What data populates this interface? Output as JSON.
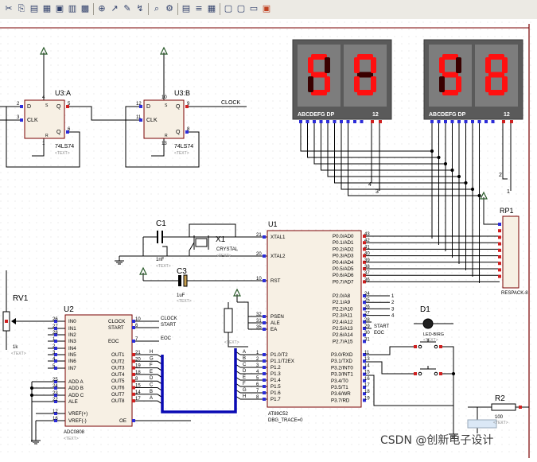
{
  "toolbar": {
    "icons": [
      "cut-icon",
      "copy-icon",
      "paste-icon",
      "block-copy-icon",
      "block-move-icon",
      "block-rotate-icon",
      "block-delete-icon",
      "zoom-in-icon",
      "pick-device-icon",
      "make-device-icon",
      "wire-autorouter-icon",
      "search-icon",
      "property-tool-icon",
      "netlist-icon",
      "bill-of-materials-icon",
      "design-explorer-icon",
      "new-sheet-icon",
      "remove-sheet-icon",
      "zoom-to-child-icon",
      "report-icon"
    ]
  },
  "display1": {
    "digits": [
      "5",
      "0"
    ],
    "pins": "ABCDEFG DP",
    "pin2": "12"
  },
  "display2": {
    "digits": [
      "5",
      "8"
    ],
    "pins": "ABCDEFG DP",
    "pin2": "12"
  },
  "flipflops": [
    {
      "ref": "U3:A",
      "part": "74LS74",
      "text": "<TEXT>",
      "d": "D",
      "q": "Q",
      "clk": "CLK",
      "qbar": "Q",
      "pin_d": "2",
      "pin_q": "5",
      "pin_clk": "3",
      "pin_qbar": "6",
      "pin_s": "4",
      "pin_r": "1"
    },
    {
      "ref": "U3:B",
      "part": "74LS74",
      "text": "<TEXT>",
      "d": "D",
      "q": "Q",
      "clk": "CLK",
      "qbar": "Q",
      "pin_d": "12",
      "pin_q": "9",
      "pin_clk": "11",
      "pin_qbar": "8",
      "pin_s": "10",
      "pin_r": "13"
    }
  ],
  "clock_net": "CLOCK",
  "c1": {
    "ref": "C1",
    "value": "1nF",
    "text": "<TEXT>"
  },
  "x1": {
    "ref": "X1",
    "value": "CRYSTAL",
    "text": "<TEXT>"
  },
  "c3": {
    "ref": "C3",
    "value": "1uF",
    "text": "<TEXT>"
  },
  "rv1": {
    "ref": "RV1",
    "value": "1k",
    "text": "<TEXT>"
  },
  "d1": {
    "ref": "D1",
    "value": "LED-BIRG",
    "text": "<TEXT>"
  },
  "r2": {
    "ref": "R2",
    "value": "100",
    "text": "<TEXT>"
  },
  "rp1": {
    "ref": "RP1",
    "value": "RESPACK-8",
    "text": "<TEXT>"
  },
  "u1": {
    "ref": "U1",
    "part": "AT89C52",
    "trace": "DBG_TRACE=0",
    "left_pins": [
      {
        "name": "XTAL1",
        "num": "21"
      },
      {
        "name": "XTAL2",
        "num": "20"
      },
      {
        "name": "RST",
        "num": "10"
      },
      {
        "name": "PSEN",
        "num": "32"
      },
      {
        "name": "ALE",
        "num": "31"
      },
      {
        "name": "EA",
        "num": "35"
      },
      {
        "name": "P1.0/T2",
        "num": "1"
      },
      {
        "name": "P1.1/T2EX",
        "num": "2"
      },
      {
        "name": "P1.2",
        "num": "3"
      },
      {
        "name": "P1.3",
        "num": "4"
      },
      {
        "name": "P1.4",
        "num": "5"
      },
      {
        "name": "P1.5",
        "num": "6"
      },
      {
        "name": "P1.6",
        "num": "7"
      },
      {
        "name": "P1.7",
        "num": "8"
      }
    ],
    "p0_pins": [
      {
        "name": "P0.0/AD0",
        "num": "43"
      },
      {
        "name": "P0.1/AD1",
        "num": "42"
      },
      {
        "name": "P0.2/AD2",
        "num": "41"
      },
      {
        "name": "P0.3/AD3",
        "num": "40"
      },
      {
        "name": "P0.4/AD4",
        "num": "39"
      },
      {
        "name": "P0.5/AD5",
        "num": "38"
      },
      {
        "name": "P0.6/AD6",
        "num": "37"
      },
      {
        "name": "P0.7/AD7",
        "num": "36"
      }
    ],
    "p2_pins": [
      {
        "name": "P2.0/A8",
        "num": "24"
      },
      {
        "name": "P2.1/A9",
        "num": "25"
      },
      {
        "name": "P2.2/A10",
        "num": "26"
      },
      {
        "name": "P2.3/A11",
        "num": "27"
      },
      {
        "name": "P2.4/A12",
        "num": "28"
      },
      {
        "name": "P2.5/A13",
        "num": "29"
      },
      {
        "name": "P2.6/A14",
        "num": "30"
      },
      {
        "name": "P2.7/A15",
        "num": "31"
      }
    ],
    "p3_pins": [
      {
        "name": "P3.0/RXD",
        "num": "11"
      },
      {
        "name": "P3.1/TXD",
        "num": "13"
      },
      {
        "name": "P3.2/INT0",
        "num": "14"
      },
      {
        "name": "P3.3/INT1",
        "num": "15"
      },
      {
        "name": "P3.4/T0",
        "num": "16"
      },
      {
        "name": "P3.5/T1",
        "num": "17"
      },
      {
        "name": "P3.6/WR",
        "num": "18"
      },
      {
        "name": "P3.7/RD",
        "num": "19"
      }
    ],
    "p2_nets": [
      "1",
      "2",
      "3",
      "4"
    ],
    "start_net": "START",
    "eoc_net": "EOC"
  },
  "u2": {
    "ref": "U2",
    "part": "ADC0808",
    "text": "<TEXT>",
    "left_pins": [
      {
        "name": "IN0",
        "num": "26"
      },
      {
        "name": "IN1",
        "num": "27"
      },
      {
        "name": "IN2",
        "num": "28"
      },
      {
        "name": "IN3",
        "num": "1"
      },
      {
        "name": "IN4",
        "num": "2"
      },
      {
        "name": "IN5",
        "num": "3"
      },
      {
        "name": "IN6",
        "num": "4"
      },
      {
        "name": "IN7",
        "num": "5"
      },
      {
        "name": "ADD A",
        "num": "25"
      },
      {
        "name": "ADD B",
        "num": "24"
      },
      {
        "name": "ADD C",
        "num": "23"
      },
      {
        "name": "ALE",
        "num": "22"
      },
      {
        "name": "VREF(+)",
        "num": "12"
      },
      {
        "name": "VREF(-)",
        "num": "16"
      }
    ],
    "right_top": [
      {
        "name": "CLOCK",
        "num": "10",
        "net": "CLOCK"
      },
      {
        "name": "START",
        "num": "6",
        "net": "START"
      },
      {
        "name": "EOC",
        "num": "7",
        "net": "EOC"
      }
    ],
    "outs": [
      {
        "name": "OUT1",
        "num": "21",
        "net": "H"
      },
      {
        "name": "OUT2",
        "num": "20",
        "net": "G"
      },
      {
        "name": "OUT3",
        "num": "19",
        "net": "F"
      },
      {
        "name": "OUT4",
        "num": "18",
        "net": "E"
      },
      {
        "name": "OUT5",
        "num": "8",
        "net": "D"
      },
      {
        "name": "OUT6",
        "num": "15",
        "net": "C"
      },
      {
        "name": "OUT7",
        "num": "14",
        "net": "B"
      },
      {
        "name": "OUT8",
        "num": "17",
        "net": "A"
      }
    ],
    "oe": {
      "name": "OE",
      "num": "9"
    }
  },
  "p1_nets": [
    "A",
    "B",
    "C",
    "D",
    "E",
    "F",
    "G",
    "H"
  ],
  "watermark": "CSDN @创新电子设计"
}
